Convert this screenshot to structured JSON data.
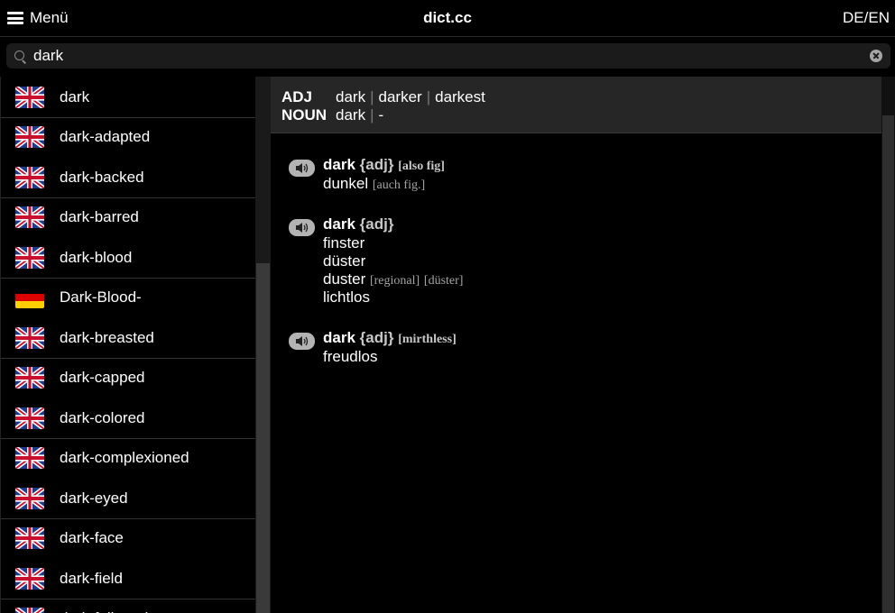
{
  "header": {
    "menu_label": "Menü",
    "title": "dict.cc",
    "lang_pair": "DE/EN"
  },
  "search": {
    "value": "dark"
  },
  "word_list": [
    {
      "label": "dark",
      "flag": "uk-flag"
    },
    {
      "label": "dark-adapted",
      "flag": "uk-flag"
    },
    {
      "label": "dark-backed",
      "flag": "uk-flag"
    },
    {
      "label": "dark-barred",
      "flag": "uk-flag"
    },
    {
      "label": "dark-blood",
      "flag": "uk-flag"
    },
    {
      "label": "Dark-Blood-",
      "flag": "de-flag"
    },
    {
      "label": "dark-breasted",
      "flag": "uk-flag"
    },
    {
      "label": "dark-capped",
      "flag": "uk-flag"
    },
    {
      "label": "dark-colored",
      "flag": "uk-flag"
    },
    {
      "label": "dark-complexioned",
      "flag": "uk-flag"
    },
    {
      "label": "dark-eyed",
      "flag": "uk-flag"
    },
    {
      "label": "dark-face",
      "flag": "uk-flag"
    },
    {
      "label": "dark-field",
      "flag": "uk-flag"
    },
    {
      "label": "dark-foliaged",
      "flag": "uk-flag"
    }
  ],
  "inflections": {
    "adj": {
      "tag": "ADJ",
      "forms": [
        "dark",
        "darker",
        "darkest"
      ]
    },
    "noun": {
      "tag": "NOUN",
      "forms": [
        "dark",
        "-"
      ]
    }
  },
  "entries": [
    {
      "headword": "dark",
      "pos": "{adj}",
      "tag": "[also fig]",
      "translations": [
        {
          "text": "dunkel",
          "tags": [
            "[auch fig.]"
          ]
        }
      ]
    },
    {
      "headword": "dark",
      "pos": "{adj}",
      "tag": "",
      "translations": [
        {
          "text": "finster",
          "tags": []
        },
        {
          "text": "düster",
          "tags": []
        },
        {
          "text": "duster",
          "tags": [
            "[regional]",
            "[düster]"
          ]
        },
        {
          "text": "lichtlos",
          "tags": []
        }
      ]
    },
    {
      "headword": "dark",
      "pos": "{adj}",
      "tag": "[mirthless]",
      "translations": [
        {
          "text": "freudlos",
          "tags": []
        }
      ]
    }
  ],
  "icons": {
    "menu": "hamburger-menu-icon",
    "search": "search-icon",
    "clear": "clear-icon",
    "sound": "speaker-icon"
  }
}
